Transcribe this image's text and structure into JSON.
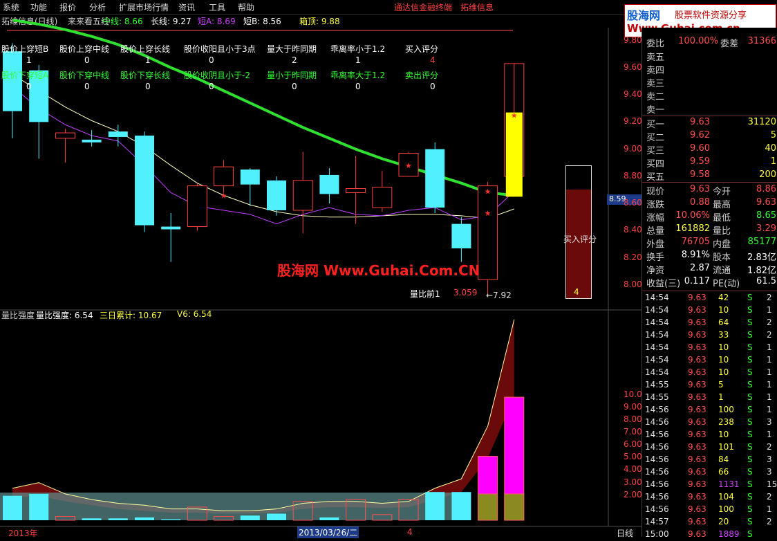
{
  "menu": {
    "items": [
      "系统",
      "功能",
      "报价",
      "分析",
      "扩展市场行情",
      "资讯",
      "工具",
      "帮助"
    ],
    "link1": "通达信金融终端",
    "link2": "拓维信息"
  },
  "logo": {
    "cn": "股海网",
    "tag": "股票软件资源分享",
    "url": "Www.Guhai.com.cn"
  },
  "indicator_row": {
    "stock": "拓维信息(日线)",
    "name": "来来看五线",
    "mid": "中线: 8.66",
    "long": "长线: 9.27",
    "shortA": "短A: 8.69",
    "shortB": "短B: 8.56",
    "box": "箱顶: 9.88"
  },
  "signals_top": {
    "labels": [
      "股价上穿短B",
      "股价上穿中线",
      "股价上穿长线",
      "股价收阳且小于3点",
      "量大于昨同期",
      "乖离率小于1.2",
      "买入评分"
    ],
    "values": [
      "1",
      "0",
      "1",
      "0",
      "2",
      "1",
      "4"
    ]
  },
  "signals_bottom": {
    "labels": [
      "股价下穿短A",
      "股价下穿中线",
      "股价下穿长线",
      "股价收阴且小于-2",
      "量小于昨同期",
      "乖离率大于1.2",
      "卖出评分"
    ],
    "values": [
      "0",
      "0",
      "0",
      "0",
      "0",
      "0",
      "0"
    ]
  },
  "main_chart": {
    "y_ticks": [
      "9.80",
      "9.60",
      "9.40",
      "9.20",
      "9.00",
      "8.80",
      "8.60",
      "8.40",
      "8.20",
      "8.00"
    ],
    "current_price": "8.59",
    "score_label": "买入评分",
    "score_value": "4",
    "vol_ratio_label": "量比前1",
    "vol_ratio_value": "3.059",
    "low_mark": "←7.92"
  },
  "sub_chart": {
    "title": "量比强度",
    "v1": "量比强度: 6.54",
    "v2": "三日累计: 10.67",
    "v3": "V6: 6.54",
    "y_ticks": [
      "10.00",
      "9.00",
      "8.00",
      "7.00",
      "6.00",
      "5.00",
      "4.00",
      "3.00",
      "2.00"
    ]
  },
  "watermark": "股海网 Www.Guhai.Com.CN",
  "bottom_bar": {
    "year": "2013年",
    "date": "2013/03/26/二",
    "num": "4",
    "period": "日线"
  },
  "quote_panel": {
    "wei": {
      "label": "委比",
      "value": "100.00%",
      "label2": "委差",
      "value2": "31366"
    },
    "sells": [
      {
        "label": "卖五",
        "price": "",
        "vol": ""
      },
      {
        "label": "卖四",
        "price": "",
        "vol": ""
      },
      {
        "label": "卖三",
        "price": "",
        "vol": ""
      },
      {
        "label": "卖二",
        "price": "",
        "vol": ""
      },
      {
        "label": "卖一",
        "price": "",
        "vol": ""
      }
    ],
    "buys": [
      {
        "label": "买一",
        "price": "9.63",
        "vol": "31120"
      },
      {
        "label": "买二",
        "price": "9.62",
        "vol": "5"
      },
      {
        "label": "买三",
        "price": "9.60",
        "vol": "40"
      },
      {
        "label": "买四",
        "price": "9.59",
        "vol": "1"
      },
      {
        "label": "买五",
        "price": "9.58",
        "vol": "200"
      }
    ],
    "stats": [
      {
        "l1": "现价",
        "v1": "9.63",
        "l2": "今开",
        "v2": "8.86"
      },
      {
        "l1": "涨跌",
        "v1": "0.88",
        "l2": "最高",
        "v2": "9.63"
      },
      {
        "l1": "涨幅",
        "v1": "10.06%",
        "l2": "最低",
        "v2": "8.65"
      },
      {
        "l1": "总量",
        "v1": "161882",
        "l2": "量比",
        "v2": "3.29"
      },
      {
        "l1": "外盘",
        "v1": "76705",
        "l2": "内盘",
        "v2": "85177"
      },
      {
        "l1": "换手",
        "v1": "8.91%",
        "l2": "股本",
        "v2": "2.83亿"
      },
      {
        "l1": "净资",
        "v1": "2.87",
        "l2": "流通",
        "v2": "1.82亿"
      },
      {
        "l1": "收益(三)",
        "v1": "0.117",
        "l2": "PE(动)",
        "v2": "61.5"
      }
    ],
    "ticks": [
      {
        "t": "14:54",
        "p": "9.63",
        "v": "42",
        "s": "S",
        "n": "2"
      },
      {
        "t": "14:54",
        "p": "9.63",
        "v": "10",
        "s": "S",
        "n": "1"
      },
      {
        "t": "14:54",
        "p": "9.63",
        "v": "64",
        "s": "S",
        "n": "2"
      },
      {
        "t": "14:54",
        "p": "9.63",
        "v": "33",
        "s": "S",
        "n": "2"
      },
      {
        "t": "14:54",
        "p": "9.63",
        "v": "10",
        "s": "S",
        "n": "1"
      },
      {
        "t": "14:54",
        "p": "9.63",
        "v": "10",
        "s": "S",
        "n": "1"
      },
      {
        "t": "14:54",
        "p": "9.63",
        "v": "10",
        "s": "S",
        "n": "1"
      },
      {
        "t": "14:55",
        "p": "9.63",
        "v": "5",
        "s": "S",
        "n": "1"
      },
      {
        "t": "14:55",
        "p": "9.63",
        "v": "1",
        "s": "S",
        "n": "1"
      },
      {
        "t": "14:56",
        "p": "9.63",
        "v": "100",
        "s": "S",
        "n": "1"
      },
      {
        "t": "14:56",
        "p": "9.63",
        "v": "238",
        "s": "S",
        "n": "3"
      },
      {
        "t": "14:56",
        "p": "9.63",
        "v": "10",
        "s": "S",
        "n": "1"
      },
      {
        "t": "14:56",
        "p": "9.63",
        "v": "101",
        "s": "S",
        "n": "2"
      },
      {
        "t": "14:56",
        "p": "9.63",
        "v": "84",
        "s": "S",
        "n": "3"
      },
      {
        "t": "14:56",
        "p": "9.63",
        "v": "66",
        "s": "S",
        "n": "3"
      },
      {
        "t": "14:56",
        "p": "9.63",
        "v": "1131",
        "s": "S",
        "n": "15"
      },
      {
        "t": "14:56",
        "p": "9.63",
        "v": "104",
        "s": "S",
        "n": "2"
      },
      {
        "t": "14:56",
        "p": "9.63",
        "v": "100",
        "s": "S",
        "n": "1"
      },
      {
        "t": "14:57",
        "p": "9.63",
        "v": "20",
        "s": "S",
        "n": "2"
      },
      {
        "t": "15:00",
        "p": "9.63",
        "v": "1889",
        "s": "S",
        "n": ""
      }
    ]
  },
  "chart_data": {
    "type": "candlestick",
    "candles": [
      {
        "o": 9.72,
        "c": 9.28,
        "h": 9.78,
        "l": 9.08,
        "up": false
      },
      {
        "o": 9.58,
        "c": 9.2,
        "h": 9.62,
        "l": 8.93,
        "up": false
      },
      {
        "o": 9.08,
        "c": 9.12,
        "h": 9.15,
        "l": 8.9,
        "up": true
      },
      {
        "o": 9.07,
        "c": 9.05,
        "h": 9.14,
        "l": 9.02,
        "up": false
      },
      {
        "o": 9.13,
        "c": 9.09,
        "h": 9.18,
        "l": 9.02,
        "up": false
      },
      {
        "o": 9.1,
        "c": 8.44,
        "h": 9.13,
        "l": 8.39,
        "up": false
      },
      {
        "o": 8.43,
        "c": 8.41,
        "h": 8.53,
        "l": 8.17,
        "up": false
      },
      {
        "o": 8.43,
        "c": 8.73,
        "h": 8.75,
        "l": 8.4,
        "up": true
      },
      {
        "o": 8.73,
        "c": 8.87,
        "h": 8.92,
        "l": 8.68,
        "up": true
      },
      {
        "o": 8.85,
        "c": 8.74,
        "h": 8.86,
        "l": 8.58,
        "up": false
      },
      {
        "o": 8.77,
        "c": 8.55,
        "h": 8.8,
        "l": 8.51,
        "up": false
      },
      {
        "o": 8.55,
        "c": 8.77,
        "h": 8.98,
        "l": 8.38,
        "up": true
      },
      {
        "o": 8.81,
        "c": 8.67,
        "h": 8.86,
        "l": 8.6,
        "up": false
      },
      {
        "o": 8.68,
        "c": 8.71,
        "h": 8.95,
        "l": 8.45,
        "up": true
      },
      {
        "o": 8.57,
        "c": 8.72,
        "h": 8.84,
        "l": 8.54,
        "up": true
      },
      {
        "o": 8.8,
        "c": 8.97,
        "h": 8.98,
        "l": 8.8,
        "up": true
      },
      {
        "o": 9.0,
        "c": 8.57,
        "h": 9.05,
        "l": 8.53,
        "up": false
      },
      {
        "o": 8.45,
        "c": 8.27,
        "h": 8.5,
        "l": 8.17,
        "up": false
      },
      {
        "o": 8.04,
        "c": 8.73,
        "h": 8.76,
        "l": 7.92,
        "up": true
      },
      {
        "o": 8.65,
        "c": 9.27,
        "h": 9.63,
        "l": 8.65,
        "up": true
      }
    ],
    "mid_line": [
      9.95,
      9.92,
      9.88,
      9.83,
      9.77,
      9.69,
      9.6,
      9.52,
      9.43,
      9.34,
      9.25,
      9.16,
      9.08,
      9.0,
      8.93,
      8.87,
      8.81,
      8.75,
      8.68,
      8.66
    ],
    "long_line": [
      9.55,
      9.43,
      9.31,
      9.21,
      9.13,
      9.02,
      8.88,
      8.75,
      8.66,
      8.59,
      8.54,
      8.51,
      8.5,
      8.5,
      8.51,
      8.52,
      8.52,
      8.51,
      8.49,
      8.56
    ],
    "short_line": [
      9.46,
      9.3,
      9.18,
      9.1,
      9.06,
      8.88,
      8.68,
      8.58,
      8.55,
      8.52,
      8.45,
      8.52,
      8.57,
      8.52,
      8.51,
      8.55,
      8.57,
      8.48,
      8.51,
      8.69
    ],
    "volume": [
      1.3,
      1.4,
      0.2,
      0.1,
      0.1,
      0.15,
      0.05,
      0.7,
      0.2,
      0.25,
      0.35,
      1.0,
      0.15,
      1.1,
      0.3,
      1.1,
      1.5,
      1.5,
      3.4,
      6.54
    ],
    "vol_up": [
      false,
      false,
      true,
      false,
      false,
      false,
      false,
      true,
      true,
      false,
      false,
      true,
      false,
      true,
      true,
      true,
      false,
      false,
      true,
      true
    ],
    "strength_line": [
      1.7,
      2.0,
      1.4,
      1.1,
      0.9,
      0.8,
      0.6,
      0.6,
      0.5,
      0.5,
      0.6,
      0.9,
      1.0,
      1.0,
      0.9,
      1.0,
      1.7,
      2.2,
      5.0,
      10.67
    ],
    "strength_band_lo": [
      1.2,
      1.3,
      1.0,
      0.8,
      0.6,
      0.5,
      0.4,
      0.4,
      0.35,
      0.35,
      0.4,
      0.6,
      0.7,
      0.7,
      0.65,
      0.7,
      1.1,
      1.5,
      3.3,
      6.54
    ]
  }
}
